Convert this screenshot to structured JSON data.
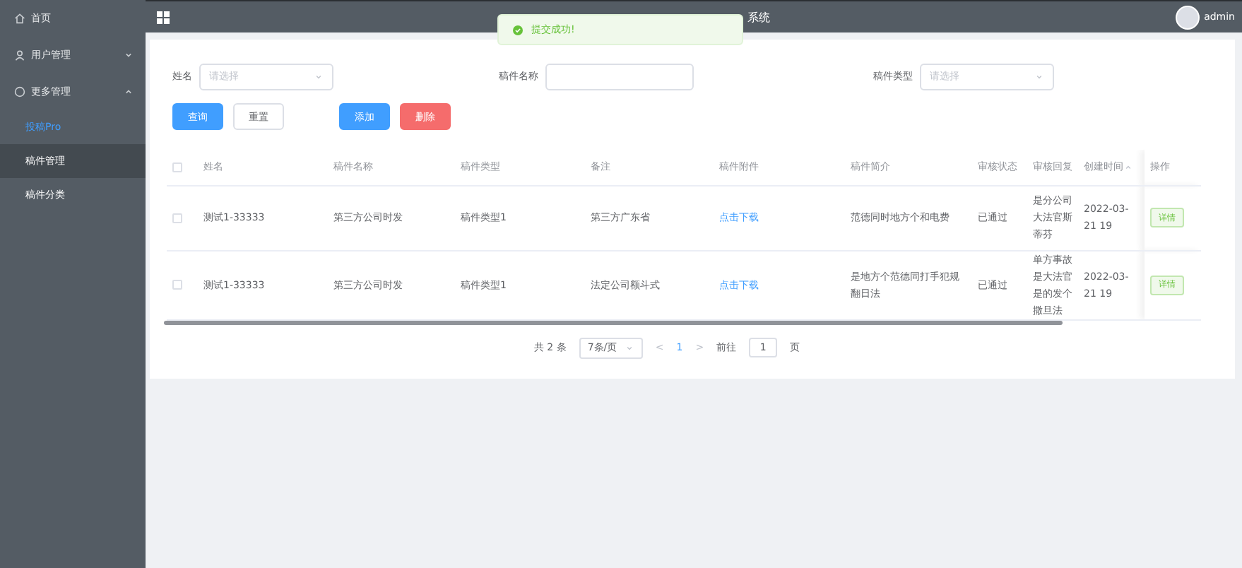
{
  "sidebar": {
    "items": [
      {
        "label": "首页",
        "selected": false
      },
      {
        "label": "用户管理",
        "selected": false,
        "expanded": false
      },
      {
        "label": "更多管理",
        "selected": false,
        "expanded": true,
        "children": [
          {
            "label": "投稿Pro",
            "selected": false,
            "kind": "link"
          },
          {
            "label": "稿件管理",
            "selected": true,
            "kind": "item"
          },
          {
            "label": "稿件分类",
            "selected": false,
            "kind": "item"
          }
        ]
      }
    ]
  },
  "header": {
    "title": "系统",
    "user": "admin"
  },
  "toast": {
    "message": "提交成功!"
  },
  "filters": [
    {
      "label": "姓名",
      "kind": "select",
      "placeholder": "请选择"
    },
    {
      "label": "稿件名称",
      "kind": "input"
    },
    {
      "label": "稿件类型",
      "kind": "select",
      "placeholder": "请选择"
    }
  ],
  "buttons": [
    {
      "label": "查询",
      "kind": "primary"
    },
    {
      "label": "重置",
      "kind": "plain"
    },
    {
      "label": "添加",
      "kind": "primary"
    },
    {
      "label": "删除",
      "kind": "danger"
    }
  ],
  "table": {
    "columns": [
      "姓名",
      "稿件名称",
      "稿件类型",
      "备注",
      "稿件附件",
      "稿件简介",
      "审核状态",
      "审核回复",
      "创建时间",
      "操作"
    ],
    "all_checked": false,
    "rows": [
      {
        "checked": false,
        "cells": [
          "测试1-33333",
          "第三方公司时发",
          "稿件类型1",
          "第三方广东省",
          "点击下载",
          "范德同时地方个和电费",
          "已通过",
          "是分公司大法官斯蒂芬",
          "2022-03-21 19"
        ],
        "action": "详情"
      },
      {
        "checked": false,
        "cells": [
          "测试1-33333",
          "第三方公司时发",
          "稿件类型1",
          "法定公司额斗式",
          "点击下载",
          "是地方个范德同打手犯规翻日法",
          "已通过",
          "单方事故是大法官是的发个撒旦法",
          "2022-03-21 19"
        ],
        "action": "详情"
      }
    ]
  },
  "pagination": {
    "total": "共 2 条",
    "page_size": "7条/页",
    "prev": "<",
    "pages": [
      {
        "label": "1",
        "selected": true
      }
    ],
    "next": ">",
    "goto_label": "前往",
    "goto_value": "1",
    "goto_suffix": "页"
  }
}
